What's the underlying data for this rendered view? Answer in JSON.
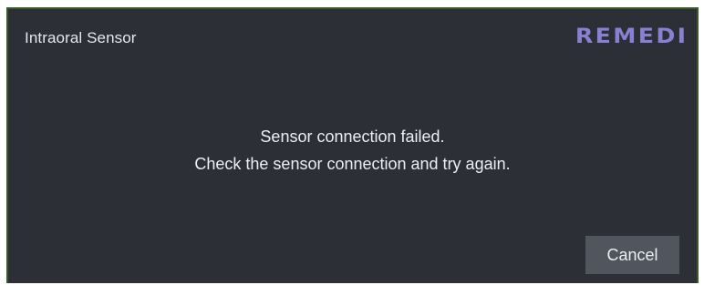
{
  "dialog": {
    "title": "Intraoral Sensor",
    "logo_text": "REMEDI",
    "message_line1": "Sensor connection failed.",
    "message_line2": "Check the sensor connection and try again.",
    "cancel_label": "Cancel"
  },
  "colors": {
    "background": "#2c2f36",
    "border": "#3a5a2c",
    "logo": "#8b7fd4",
    "button": "#50555e",
    "text": "#eceef1"
  }
}
